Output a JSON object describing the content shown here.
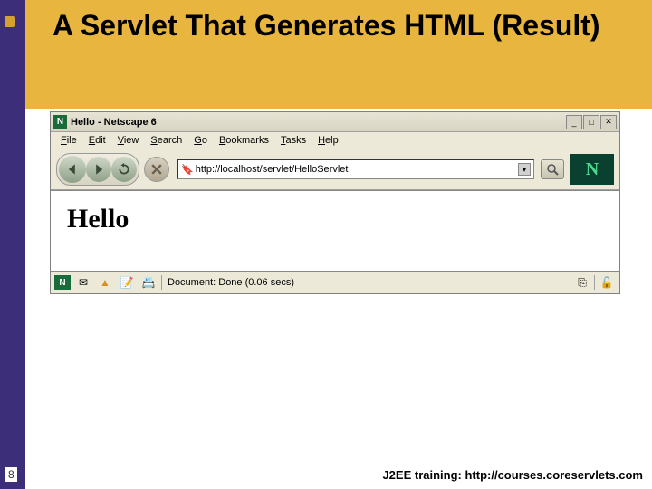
{
  "slide": {
    "title": "A Servlet That Generates HTML (Result)",
    "page_number": "8",
    "footer": "J2EE training: http://courses.coreservlets.com"
  },
  "browser": {
    "window_title": "Hello - Netscape 6",
    "menu": {
      "file": "File",
      "edit": "Edit",
      "view": "View",
      "search": "Search",
      "go": "Go",
      "bookmarks": "Bookmarks",
      "tasks": "Tasks",
      "help": "Help"
    },
    "url": "http://localhost/servlet/HelloServlet",
    "throbber": "N",
    "page_heading": "Hello",
    "status": "Document: Done (0.06 secs)"
  }
}
